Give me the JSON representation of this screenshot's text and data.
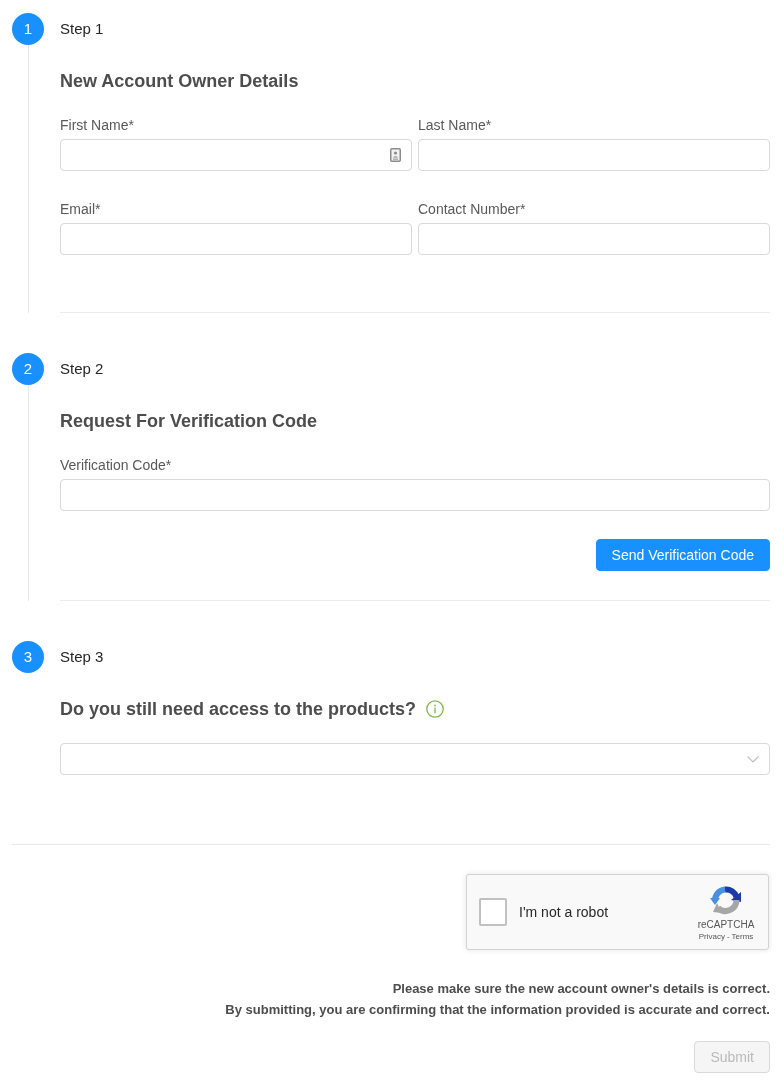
{
  "steps": [
    {
      "number": "1",
      "title": "Step 1",
      "heading": "New Account Owner Details",
      "info_icon": false,
      "rows": [
        [
          {
            "kind": "autofill-input",
            "label": "First Name*"
          },
          {
            "kind": "input",
            "label": "Last Name*"
          }
        ],
        [
          {
            "kind": "input",
            "label": "Email*"
          },
          {
            "kind": "input",
            "label": "Contact Number*"
          }
        ]
      ]
    },
    {
      "number": "2",
      "title": "Step 2",
      "heading": "Request For Verification Code",
      "info_icon": false,
      "rows": [
        [
          {
            "kind": "input",
            "label": "Verification Code*"
          }
        ]
      ],
      "button": {
        "label": "Send Verification Code"
      }
    },
    {
      "number": "3",
      "title": "Step 3",
      "heading": "Do you still need access to the products?",
      "info_icon": true,
      "rows": [
        [
          {
            "kind": "select"
          }
        ]
      ]
    }
  ],
  "captcha": {
    "label": "I'm not a robot",
    "checked": false,
    "brand": "reCAPTCHA",
    "links": [
      "Privacy",
      "Terms"
    ],
    "separator": "-"
  },
  "notice": [
    "Please make sure the new account owner's details is correct.",
    "By submitting, you are confirming that the information provided is accurate and correct."
  ],
  "submit": {
    "label": "Submit",
    "disabled": true
  }
}
